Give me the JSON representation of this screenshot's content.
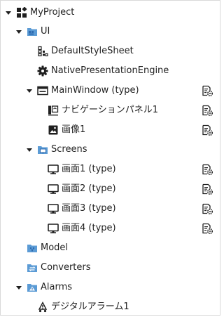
{
  "tree": {
    "root": {
      "label": "MyProject",
      "icon": "grid-icon",
      "expanded": true
    },
    "ui": {
      "label": "UI",
      "icon": "blue-folder-icon",
      "expanded": true
    },
    "default_style_sheet": {
      "label": "DefaultStyleSheet",
      "icon": "style-sheet-icon"
    },
    "native_presentation_engine": {
      "label": "NativePresentationEngine",
      "icon": "gear-icon"
    },
    "main_window": {
      "label": "MainWindow (type)",
      "icon": "window-icon",
      "expanded": true
    },
    "nav_panel": {
      "label": "ナビゲーションパネル1",
      "icon": "navigation-panel-icon"
    },
    "image1": {
      "label": "画像1",
      "icon": "image-icon"
    },
    "screens": {
      "label": "Screens",
      "icon": "screens-folder-icon",
      "expanded": true
    },
    "screen_items": [
      {
        "label": "画面1 (type)",
        "icon": "monitor-icon"
      },
      {
        "label": "画面2 (type)",
        "icon": "monitor-icon"
      },
      {
        "label": "画面3 (type)",
        "icon": "monitor-icon"
      },
      {
        "label": "画面4 (type)",
        "icon": "monitor-icon"
      }
    ],
    "model": {
      "label": "Model",
      "icon": "model-folder-icon"
    },
    "converters": {
      "label": "Converters",
      "icon": "converters-folder-icon"
    },
    "alarms": {
      "label": "Alarms",
      "icon": "alarms-folder-icon",
      "expanded": true
    },
    "digital_alarm": {
      "label": "デジタルアラーム1",
      "icon": "alarm-bell-icon"
    }
  },
  "colors": {
    "folder_blue": "#5b9bd5",
    "folder_dark_blue": "#2e6bb0",
    "icon_dark": "#1f1f1f"
  }
}
